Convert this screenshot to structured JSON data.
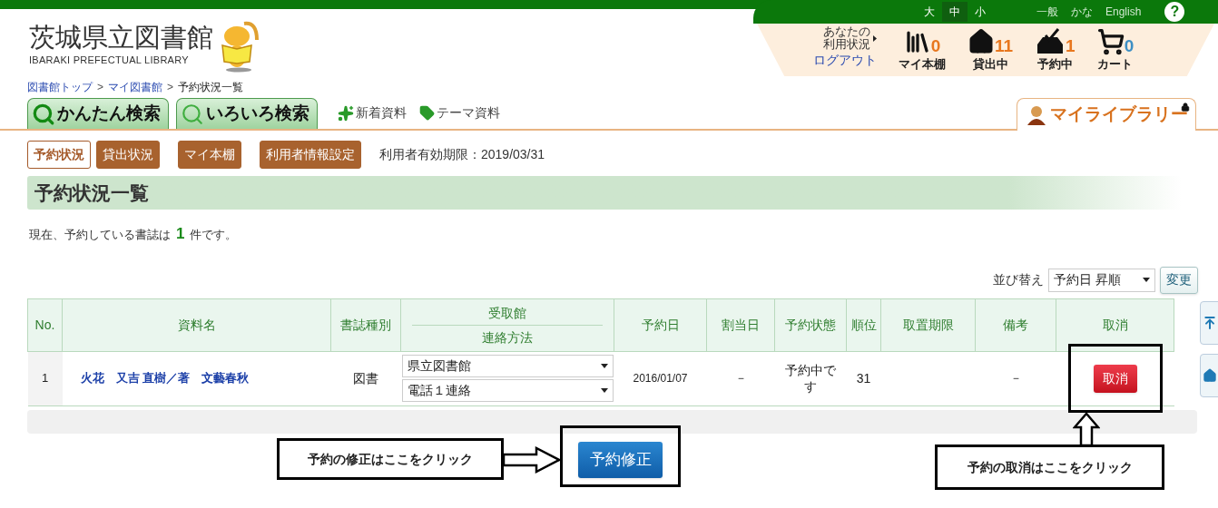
{
  "top_bar": {
    "text_sizes": [
      {
        "label": "大",
        "selected": false
      },
      {
        "label": "中",
        "selected": true
      },
      {
        "label": "小",
        "selected": false
      }
    ],
    "languages": [
      "一般",
      "かな",
      "English"
    ],
    "help_label": "?"
  },
  "logo": {
    "title": "茨城県立図書館",
    "subtitle": "IBARAKI PREFECTUAL LIBRARY"
  },
  "user_status": {
    "label_lines": [
      "あなたの",
      "利用状況"
    ],
    "logout": "ログアウト",
    "items": [
      {
        "kind": "shelf",
        "label": "マイ本棚",
        "count": "0",
        "color": "#e8771e"
      },
      {
        "kind": "loan",
        "label": "貸出中",
        "count": "11",
        "color": "#e8771e"
      },
      {
        "kind": "reserve",
        "label": "予約中",
        "count": "1",
        "color": "#e8771e"
      },
      {
        "kind": "cart",
        "label": "カート",
        "count": "0",
        "color": "#3d8fc4"
      }
    ]
  },
  "breadcrumb": {
    "separator": ">",
    "items": [
      {
        "label": "図書館トップ",
        "kind": "link"
      },
      {
        "label": "マイ図書館",
        "kind": "link"
      },
      {
        "label": "予約状況一覧",
        "kind": "current"
      }
    ]
  },
  "search_tabs": [
    {
      "label": "かんたん検索",
      "kind": "simple"
    },
    {
      "label": "いろいろ検索",
      "kind": "advanced"
    }
  ],
  "links": [
    {
      "label": "新着資料",
      "kind": "new"
    },
    {
      "label": "テーマ資料",
      "kind": "theme"
    }
  ],
  "my_library_tab": {
    "label": "マイライブラリー",
    "selected": true
  },
  "sub_nav": {
    "items": [
      {
        "label": "予約状況",
        "selected": true
      },
      {
        "label": "貸出状況",
        "selected": false
      },
      {
        "label": "マイ本棚",
        "selected": false
      },
      {
        "label": "利用者情報設定",
        "selected": false
      }
    ],
    "expiry": "利用者有効期限：2019/03/31"
  },
  "page_title": "予約状況一覧",
  "summary": {
    "before": "現在、予約している書誌は",
    "count": "1",
    "after": "件です。"
  },
  "sort": {
    "label": "並び替え",
    "value": "予約日 昇順",
    "button": "変更"
  },
  "table": {
    "columns": [
      {
        "label": "No."
      },
      {
        "label": "資料名"
      },
      {
        "label": "書誌種別"
      },
      {
        "label": "受取館",
        "sublabel": "連絡方法"
      },
      {
        "label": "予約日"
      },
      {
        "label": "割当日"
      },
      {
        "label": "予約状態"
      },
      {
        "label": "順位"
      },
      {
        "label": "取置期限"
      },
      {
        "label": "備考"
      },
      {
        "label": "取消"
      }
    ],
    "rows": [
      {
        "no": "1",
        "title": "火花　又吉 直樹／著　文藝春秋",
        "type": "図書",
        "pickup": "県立図書館",
        "contact": "電話１連絡",
        "reserve_date": "2016/01/07",
        "assigned_date": "－",
        "status": "予約中です",
        "rank": "31",
        "note": "－",
        "cancel": "取消"
      }
    ]
  },
  "submit_button": "予約修正",
  "annotations": [
    {
      "text": "予約の修正はここをクリック"
    },
    {
      "text": "予約の取消はここをクリック"
    }
  ]
}
